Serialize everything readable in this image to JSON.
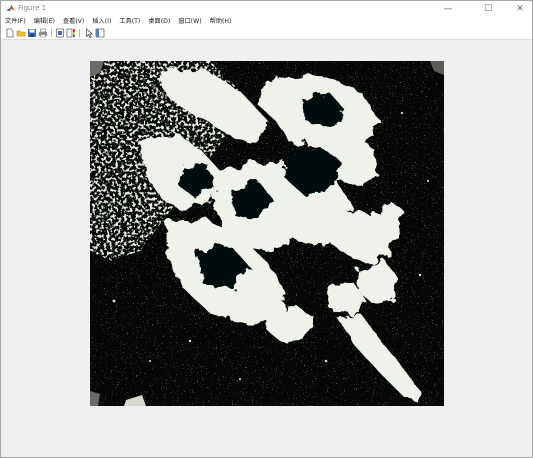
{
  "window": {
    "title": "Figure 1",
    "minimize_glyph": "—",
    "maximize_glyph": "☐",
    "close_glyph": "✕"
  },
  "menubar": {
    "items": [
      {
        "label": "文件(F)"
      },
      {
        "label": "编辑(E)"
      },
      {
        "label": "查看(V)"
      },
      {
        "label": "插入(I)"
      },
      {
        "label": "工具(T)"
      },
      {
        "label": "桌面(D)"
      },
      {
        "label": "窗口(W)"
      },
      {
        "label": "帮助(H)"
      }
    ]
  },
  "toolbar": {
    "buttons": [
      {
        "icon": "new-figure-icon"
      },
      {
        "icon": "open-file-icon"
      },
      {
        "icon": "save-icon"
      },
      {
        "icon": "print-icon"
      },
      {
        "icon": "link-plot-icon"
      },
      {
        "icon": "insert-colorbar-icon"
      },
      {
        "icon": "edit-plot-icon"
      },
      {
        "icon": "property-editor-icon"
      }
    ]
  },
  "colors": {
    "image_background": "#050807",
    "image_foreground": "#eef2ea",
    "window_background": "#f0f0f0"
  }
}
